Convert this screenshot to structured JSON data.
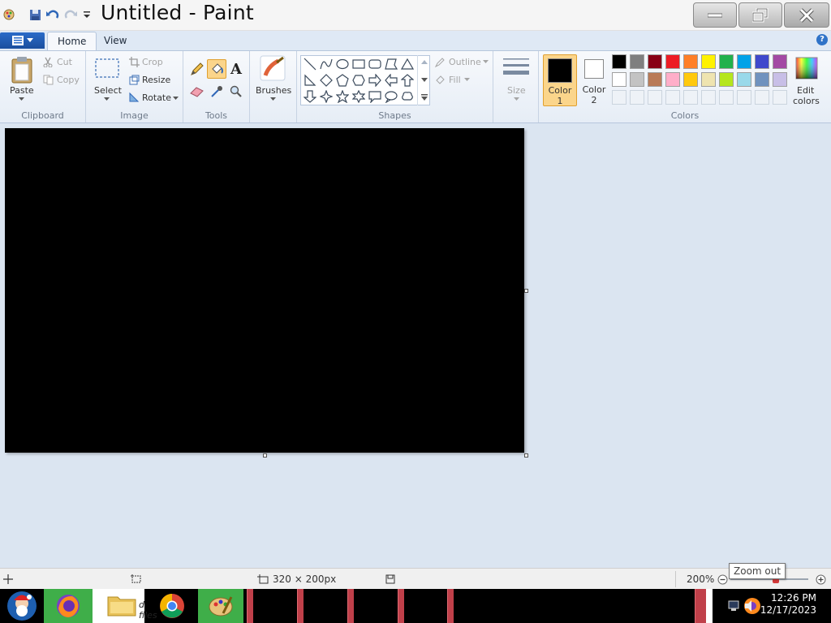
{
  "window": {
    "title": "Untitled - Paint"
  },
  "quick_access": {
    "icons": [
      "paint-app-icon",
      "save-icon",
      "undo-icon",
      "redo-icon",
      "customize-qat-icon"
    ]
  },
  "tabs": [
    {
      "label": "Home",
      "active": true
    },
    {
      "label": "View",
      "active": false
    }
  ],
  "ribbon": {
    "clipboard": {
      "paste": "Paste",
      "cut": "Cut",
      "copy": "Copy",
      "group_label": "Clipboard"
    },
    "image": {
      "select": "Select",
      "crop": "Crop",
      "resize": "Resize",
      "rotate": "Rotate",
      "group_label": "Image"
    },
    "tools": {
      "group_label": "Tools",
      "text_tool_glyph": "A",
      "active_tool": "fill"
    },
    "brushes": {
      "label": "Brushes"
    },
    "shapes": {
      "outline": "Outline",
      "fill": "Fill",
      "group_label": "Shapes"
    },
    "size": {
      "label": "Size"
    },
    "colors": {
      "color1_line1": "Color",
      "color1_line2": "1",
      "color1_value": "#000000",
      "color2_line1": "Color",
      "color2_line2": "2",
      "color2_value": "#ffffff",
      "edit_line1": "Edit",
      "edit_line2": "colors",
      "group_label": "Colors",
      "palette_row1": [
        "#000000",
        "#7f7f7f",
        "#880015",
        "#ed1c24",
        "#ff7f27",
        "#fff200",
        "#22b14c",
        "#00a2e8",
        "#3f48cc",
        "#a349a4"
      ],
      "palette_row2": [
        "#ffffff",
        "#c3c3c3",
        "#b97a57",
        "#ffaec9",
        "#ffc90e",
        "#efe4b0",
        "#b5e61d",
        "#99d9ea",
        "#7092be",
        "#c8bfe7"
      ]
    }
  },
  "canvas": {
    "background": "#000000"
  },
  "status": {
    "size_text": "320 × 200px",
    "zoom_text": "200%",
    "zoom_tooltip": "Zoom out"
  },
  "taskbar": {
    "clock_time": "12:26 PM",
    "clock_date": "12/17/2023",
    "explorer_label": "d files"
  }
}
